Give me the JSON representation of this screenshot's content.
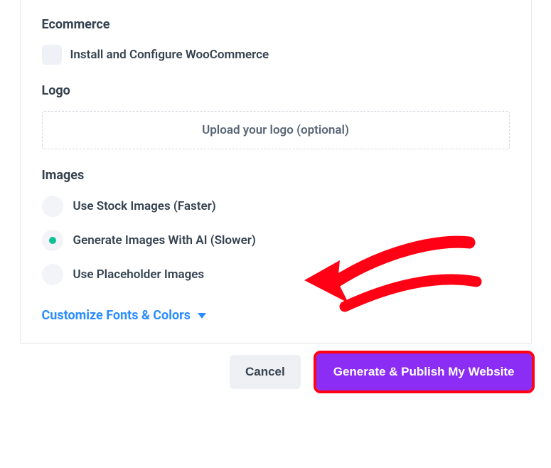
{
  "sections": {
    "ecommerce": {
      "title": "Ecommerce",
      "checkbox_label": "Install and Configure WooCommerce"
    },
    "logo": {
      "title": "Logo",
      "upload_text": "Upload your logo (optional)"
    },
    "images": {
      "title": "Images",
      "options": [
        {
          "label": "Use Stock Images (Faster)",
          "selected": false
        },
        {
          "label": "Generate Images With AI (Slower)",
          "selected": true
        },
        {
          "label": "Use Placeholder Images",
          "selected": false
        }
      ]
    }
  },
  "customize_link": "Customize Fonts & Colors",
  "buttons": {
    "cancel": "Cancel",
    "primary": "Generate & Publish My Website"
  },
  "colors": {
    "accent_primary": "#8b2df5",
    "accent_link": "#2a8cff",
    "radio_selected": "#0fbf9a",
    "highlight_outline": "#ff0014"
  }
}
